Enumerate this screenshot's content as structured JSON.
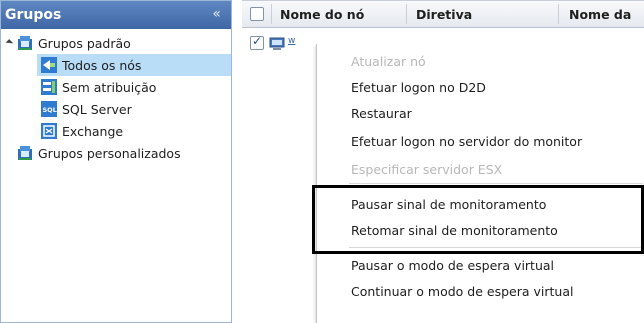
{
  "left_panel": {
    "title": "Grupos",
    "collapse_glyph": "«",
    "tree": [
      {
        "label": "Grupos padrão",
        "icon": "group-folder-icon",
        "expanded": true
      },
      {
        "label": "Todos os nós",
        "icon": "all-nodes-icon",
        "selected": true
      },
      {
        "label": "Sem atribuição",
        "icon": "unassigned-icon"
      },
      {
        "label": "SQL Server",
        "icon": "sql-server-icon"
      },
      {
        "label": "Exchange",
        "icon": "exchange-icon"
      },
      {
        "label": "Grupos personalizados",
        "icon": "group-folder-icon"
      }
    ]
  },
  "table": {
    "columns": [
      "Nome do nó",
      "Diretiva",
      "Nome da"
    ],
    "row": {
      "checked": true,
      "name_preview": "w"
    }
  },
  "context_menu": {
    "items": [
      {
        "label": "Atualizar nó",
        "disabled": true
      },
      {
        "label": "Efetuar logon no D2D",
        "disabled": false
      },
      {
        "label": "Restaurar",
        "disabled": false
      },
      {
        "label": "Efetuar logon no servidor do monitor",
        "disabled": false
      },
      {
        "label": "Especificar servidor ESX",
        "disabled": true
      },
      {
        "label": "Pausar sinal de monitoramento",
        "disabled": false
      },
      {
        "label": "Retomar sinal de monitoramento",
        "disabled": false
      },
      {
        "label": "Pausar o modo de espera virtual",
        "disabled": false
      },
      {
        "label": "Continuar o modo de espera virtual",
        "disabled": false
      }
    ]
  },
  "colors": {
    "header_blue": "#4a73b3",
    "selection": "#b9dcf7",
    "disabled_text": "#b7b7b7",
    "highlight_border": "#000000"
  }
}
